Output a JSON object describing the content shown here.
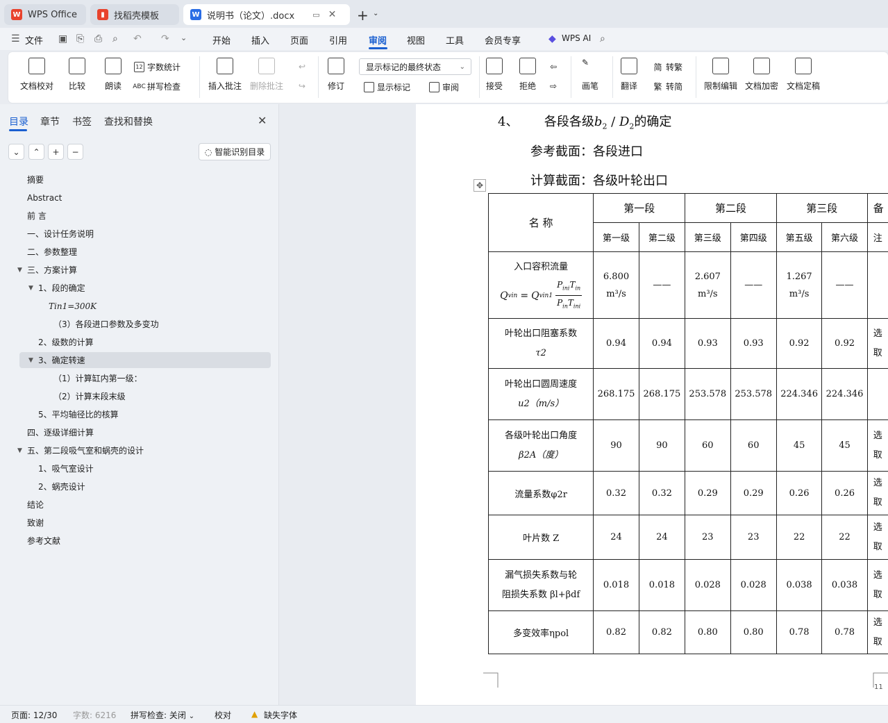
{
  "tabs": [
    {
      "label": "WPS Office"
    },
    {
      "label": "找稻壳模板"
    },
    {
      "label": "说明书（论文）.docx"
    }
  ],
  "menu": {
    "file": "文件",
    "items": [
      "开始",
      "插入",
      "页面",
      "引用",
      "审阅",
      "视图",
      "工具",
      "会员专享"
    ],
    "ai": "WPS AI"
  },
  "ribbon": {
    "proofread": "文档校对",
    "compare": "比较",
    "read_aloud": "朗读",
    "word_count": "字数统计",
    "spell_check": "拼写检查",
    "insert_comment": "插入批注",
    "delete_comment": "删除批注",
    "revise": "修订",
    "markup_select": "显示标记的最终状态",
    "show_markup": "显示标记",
    "review": "审阅",
    "accept": "接受",
    "reject": "拒绝",
    "pen": "画笔",
    "translate": "翻译",
    "to_trad": "转繁",
    "to_simp": "转简",
    "restrict_edit": "限制编辑",
    "encrypt": "文档加密",
    "finalize": "文档定稿"
  },
  "sidebar": {
    "tabs": [
      "目录",
      "章节",
      "书签",
      "查找和替换"
    ],
    "smart_toc": "智能识别目录",
    "toc": [
      {
        "label": "摘要"
      },
      {
        "label": "Abstract"
      },
      {
        "label": "前  言"
      },
      {
        "label": "一、设计任务说明"
      },
      {
        "label": "二、参数整理"
      },
      {
        "label": "三、方案计算"
      },
      {
        "label": "1、段的确定"
      },
      {
        "label": "Tin1=300K"
      },
      {
        "label": "（3）各段进口参数及多变功"
      },
      {
        "label": "2、级数的计算"
      },
      {
        "label": "3、确定转速"
      },
      {
        "label": "（1）计算缸内第一级："
      },
      {
        "label": "（2）计算末段末级"
      },
      {
        "label": "5、平均轴径比的核算"
      },
      {
        "label": "四、逐级详细计算"
      },
      {
        "label": "五、第二段吸气室和蜗壳的设计"
      },
      {
        "label": "1、吸气室设计"
      },
      {
        "label": "2、蜗壳设计"
      },
      {
        "label": "结论"
      },
      {
        "label": "致谢"
      },
      {
        "label": "参考文献"
      }
    ]
  },
  "document": {
    "heading_num": "4、",
    "heading_text": "各段各级",
    "heading_b": "b",
    "heading_b_sub": "2",
    "heading_slash": " / ",
    "heading_d": "D",
    "heading_d_sub": "2",
    "heading_tail": "的确定",
    "ref_section": "参考截面：各段进口",
    "calc_section": "计算截面：各级叶轮出口",
    "page_number": "11",
    "table": {
      "name_header": "名  称",
      "stage_headers": [
        "第一段",
        "第二段",
        "第三段"
      ],
      "remark_header_1": "备",
      "remark_header_2": "注",
      "level_headers": [
        "第一级",
        "第二级",
        "第三级",
        "第四级",
        "第五级",
        "第六级"
      ],
      "rows": [
        {
          "name": "入口容积流量",
          "symbol": "Qvin = Qvin1 · PinTin / PinTini",
          "values": [
            "6.800",
            "——",
            "2.607",
            "——",
            "1.267",
            "——"
          ],
          "unit": "m³/s",
          "remark": ""
        },
        {
          "name": "叶轮出口阻塞系数",
          "symbol": "τ2",
          "values": [
            "0.94",
            "0.94",
            "0.93",
            "0.93",
            "0.92",
            "0.92"
          ],
          "remark": "选取"
        },
        {
          "name": "叶轮出口圆周速度",
          "symbol": "u2（m/s）",
          "values": [
            "268.175",
            "268.175",
            "253.578",
            "253.578",
            "224.346",
            "224.346"
          ],
          "remark": ""
        },
        {
          "name": "各级叶轮出口角度",
          "symbol": "β2A（度）",
          "values": [
            "90",
            "90",
            "60",
            "60",
            "45",
            "45"
          ],
          "remark": "选取"
        },
        {
          "name": "流量系数φ2r",
          "symbol": "",
          "values": [
            "0.32",
            "0.32",
            "0.29",
            "0.29",
            "0.26",
            "0.26"
          ],
          "remark": "选取"
        },
        {
          "name": "叶片数 Z",
          "symbol": "",
          "values": [
            "24",
            "24",
            "23",
            "23",
            "22",
            "22"
          ],
          "remark": "选取"
        },
        {
          "name": "漏气损失系数与轮",
          "symbol": "阻损失系数 βl+βdf",
          "values": [
            "0.018",
            "0.018",
            "0.028",
            "0.028",
            "0.038",
            "0.038"
          ],
          "remark": "选取"
        },
        {
          "name": "多变效率ηpol",
          "symbol": "",
          "values": [
            "0.82",
            "0.82",
            "0.80",
            "0.80",
            "0.78",
            "0.78"
          ],
          "remark": "选取"
        }
      ]
    }
  },
  "status": {
    "page": "页面: 12/30",
    "words": "字数: 6216",
    "spell": "拼写检查: 关闭",
    "proof": "校对",
    "missing_font": "缺失字体"
  },
  "colors": {
    "accent": "#1a5fd0",
    "wps_red": "#e8432d",
    "doc_blue": "#2a6de5"
  }
}
